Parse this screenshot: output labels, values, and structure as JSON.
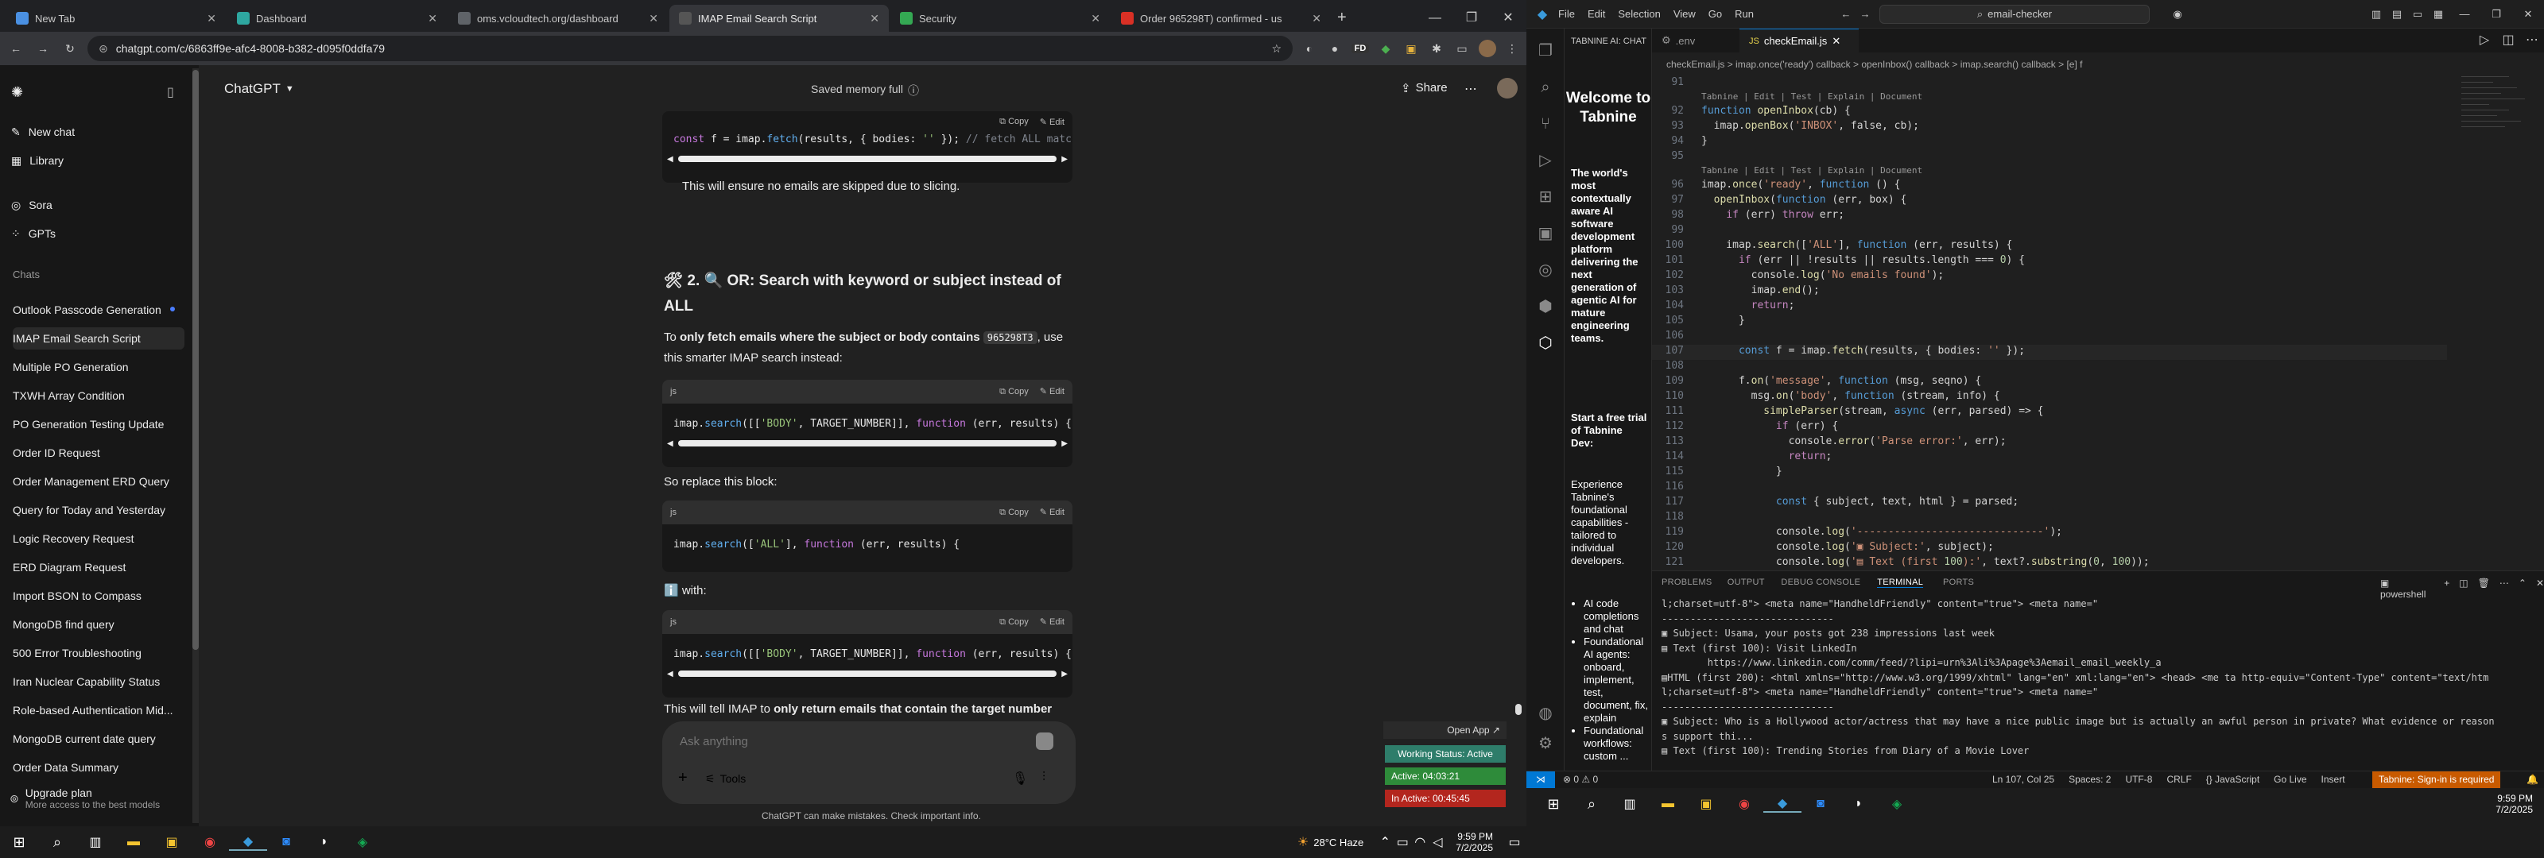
{
  "browser": {
    "tabs": [
      {
        "title": "New Tab",
        "color": "#4a90e2"
      },
      {
        "title": "Dashboard",
        "color": "#2ea7a0"
      },
      {
        "title": "oms.vcloudtech.org/dashboard",
        "color": "#5f6368"
      },
      {
        "title": "IMAP Email Search Script",
        "color": "#444"
      },
      {
        "title": "Security",
        "color": "#34a853"
      },
      {
        "title": "Order 965298T) confirmed - us",
        "color": "#d93025"
      }
    ],
    "url": "chatgpt.com/c/6863ff9e-afc4-8008-b382-d095f0ddfa79"
  },
  "chatgpt": {
    "new_chat": "New chat",
    "library": "Library",
    "sora": "Sora",
    "gpts": "GPTs",
    "chats_heading": "Chats",
    "chats": [
      "Outlook Passcode Generation",
      "IMAP Email Search Script",
      "Multiple PO Generation",
      "TXWH Array Condition",
      "PO Generation Testing Update",
      "Order ID Request",
      "Order Management ERD Query",
      "Query for Today and Yesterday",
      "Logic Recovery Request",
      "ERD Diagram Request",
      "Import BSON to Compass",
      "MongoDB find query",
      "500 Error Troubleshooting",
      "Iran Nuclear Capability Status",
      "Role-based Authentication Mid...",
      "MongoDB current date query",
      "Order Data Summary"
    ],
    "upgrade_title": "Upgrade plan",
    "upgrade_sub": "More access to the best models",
    "model": "ChatGPT",
    "memory": "Saved memory full",
    "share": "Share",
    "copy": "Copy",
    "edit": "Edit",
    "js": "js",
    "code1": "const f = imap.fetch(results, { bodies: '' }); // fetch ALL match",
    "text1": "This will ensure no emails are skipped due to slicing.",
    "heading": "🛠 2. 🔍 OR: Search with keyword or subject instead of ALL",
    "para1_a": "To ",
    "para1_b": "only fetch emails where the subject or body contains",
    "para1_code": "965298T3",
    "para1_c": ", use this smarter IMAP search instead:",
    "code2": "imap.search([['BODY', TARGET_NUMBER]], function (err, results) {",
    "replace": "So replace this block:",
    "code3": "imap.search(['ALL'], function (err, results) {",
    "with": "ℹ️ with:",
    "code4": "imap.search([['BODY', TARGET_NUMBER]], function (err, results) {",
    "text2_a": "This will tell IMAP to ",
    "text2_b": "only return emails that contain the target number",
    "placeholder": "Ask anything",
    "tools": "Tools",
    "disclaimer": "ChatGPT can make mistakes. Check important info.",
    "open_app": "Open App ↗",
    "working": "Working Status: Active",
    "active": "Active: 04:03:21",
    "inactive": "In Active: 00:45:45"
  },
  "taskbar_left": {
    "weather": "28°C  Haze",
    "time": "9:59 PM",
    "date": "7/2/2025"
  },
  "vscode": {
    "menu": [
      "File",
      "Edit",
      "Selection",
      "View",
      "Go",
      "Run"
    ],
    "search": "email-checker",
    "panel_title": "TABNINE AI: CHAT",
    "tabs": [
      ".env",
      "checkEmail.js"
    ],
    "breadcrumb": "checkEmail.js > imap.once('ready') callback > openInbox() callback > imap.search() callback > [e] f",
    "tabnine": {
      "welcome": "Welcome to Tabnine",
      "desc": "The world's most contextually aware AI software development platform delivering the next generation of agentic AI for mature engineering teams.",
      "trial": "Start a free trial of Tabnine Dev:",
      "exp": "Experience Tabnine's foundational capabilities - tailored to individual developers.",
      "bullets": [
        "AI code completions and chat",
        "Foundational AI agents: onboard, implement, test, document, fix, explain",
        "Foundational workflows: custom ..."
      ]
    },
    "lens": "Tabnine | Edit | Test | Explain | Document",
    "code_lines": [
      {
        "n": "91",
        "t": ""
      },
      {
        "n": "92",
        "t": "function openInbox(cb) {"
      },
      {
        "n": "93",
        "t": "  imap.openBox('INBOX', false, cb);"
      },
      {
        "n": "94",
        "t": "}"
      },
      {
        "n": "95",
        "t": ""
      },
      {
        "n": "96",
        "t": "imap.once('ready', function () {"
      },
      {
        "n": "97",
        "t": "  openInbox(function (err, box) {"
      },
      {
        "n": "98",
        "t": "    if (err) throw err;"
      },
      {
        "n": "99",
        "t": ""
      },
      {
        "n": "100",
        "t": "    imap.search(['ALL'], function (err, results) {"
      },
      {
        "n": "101",
        "t": "      if (err || !results || results.length === 0) {"
      },
      {
        "n": "102",
        "t": "        console.log('No emails found');"
      },
      {
        "n": "103",
        "t": "        imap.end();"
      },
      {
        "n": "104",
        "t": "        return;"
      },
      {
        "n": "105",
        "t": "      }"
      },
      {
        "n": "106",
        "t": ""
      },
      {
        "n": "107",
        "t": "      const f = imap.fetch(results, { bodies: '' });"
      },
      {
        "n": "108",
        "t": ""
      },
      {
        "n": "109",
        "t": "      f.on('message', function (msg, seqno) {"
      },
      {
        "n": "110",
        "t": "        msg.on('body', function (stream, info) {"
      },
      {
        "n": "111",
        "t": "          simpleParser(stream, async (err, parsed) => {"
      },
      {
        "n": "112",
        "t": "            if (err) {"
      },
      {
        "n": "113",
        "t": "              console.error('Parse error:', err);"
      },
      {
        "n": "114",
        "t": "              return;"
      },
      {
        "n": "115",
        "t": "            }"
      },
      {
        "n": "116",
        "t": ""
      },
      {
        "n": "117",
        "t": "            const { subject, text, html } = parsed;"
      },
      {
        "n": "118",
        "t": ""
      },
      {
        "n": "119",
        "t": "            console.log('------------------------------');"
      },
      {
        "n": "120",
        "t": "            console.log('▣ Subject:', subject);"
      },
      {
        "n": "121",
        "t": "            console.log('▤ Text (first 100):', text?.substring(0, 100));"
      }
    ],
    "panel_tabs": [
      "PROBLEMS",
      "OUTPUT",
      "DEBUG CONSOLE",
      "TERMINAL",
      "PORTS"
    ],
    "shell": "powershell",
    "terminal": [
      "l;charset=utf-8\"> <meta name=\"HandheldFriendly\" content=\"true\"> <meta name=\"",
      "------------------------------",
      "▣ Subject: Usama, your posts got 238 impressions last week",
      "▤ Text (first 100): Visit LinkedIn",
      "        https://www.linkedin.com/comm/feed/?lipi=urn%3Ali%3Apage%3Aemail_email_weekly_a",
      "▤HTML (first 200): <html xmlns=\"http://www.w3.org/1999/xhtml\" lang=\"en\" xml:lang=\"en\"> <head> <me ta http-equiv=\"Content-Type\" content=\"text/htm",
      "l;charset=utf-8\"> <meta name=\"HandheldFriendly\" content=\"true\"> <meta name=\"",
      "------------------------------",
      "▣ Subject: Who is a Hollywood actor/actress that may have a nice public image but is actually an awful person in private? What evidence or reason",
      "s support thi...",
      "▤ Text (first 100): Trending Stories from Diary of a Movie Lover"
    ],
    "status_left": "⊗ 0 ⚠ 0",
    "status_right": [
      "Ln 107, Col 25",
      "Spaces: 2",
      "UTF-8",
      "CRLF",
      "{} JavaScript",
      "Go Live",
      "Insert"
    ],
    "tabnine_status": "Tabnine: Sign-in is required",
    "time": "9:59 PM",
    "date": "7/2/2025"
  }
}
